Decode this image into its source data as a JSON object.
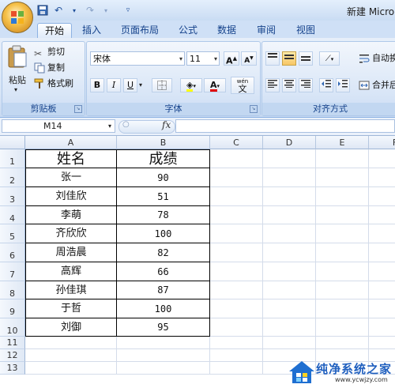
{
  "window": {
    "title": "新建 Micro-"
  },
  "ribbon_tabs": [
    "开始",
    "插入",
    "页面布局",
    "公式",
    "数据",
    "审阅",
    "视图"
  ],
  "clipboard": {
    "paste_label": "粘贴",
    "cut_label": "剪切",
    "copy_label": "复制",
    "format_painter_label": "格式刷",
    "group_label": "剪贴板"
  },
  "font": {
    "font_name": "宋体",
    "font_size": "11",
    "grow_label": "A",
    "shrink_label": "A",
    "bold_label": "B",
    "italic_label": "I",
    "underline_label": "U",
    "color_label": "A",
    "phonetic_label": "wén",
    "phonetic_char": "文",
    "group_label": "字体"
  },
  "alignment": {
    "wrap_label": "自动换",
    "merge_label": "合并后",
    "group_label": "对齐方式"
  },
  "formula_bar": {
    "name_box": "M14",
    "fx_label": "fx",
    "value": ""
  },
  "columns": [
    "A",
    "B",
    "C",
    "D",
    "E",
    "F"
  ],
  "rows": [
    "1",
    "2",
    "3",
    "4",
    "5",
    "6",
    "7",
    "8",
    "9",
    "10",
    "11",
    "12",
    "13"
  ],
  "table": {
    "headers": [
      "姓名",
      "成绩"
    ],
    "records": [
      [
        "张一",
        "90"
      ],
      [
        "刘佳欣",
        "51"
      ],
      [
        "李萌",
        "78"
      ],
      [
        "齐欣欣",
        "100"
      ],
      [
        "周浩晨",
        "82"
      ],
      [
        "高辉",
        "66"
      ],
      [
        "孙佳琪",
        "87"
      ],
      [
        "于哲",
        "100"
      ],
      [
        "刘御",
        "95"
      ]
    ]
  },
  "watermark": {
    "title": "纯净系统之家",
    "url": "www.ycwjzy.com"
  },
  "colors": {
    "accent": "#15428b",
    "ribbon": "#d6e4f6",
    "header": "#dfe8f5"
  }
}
